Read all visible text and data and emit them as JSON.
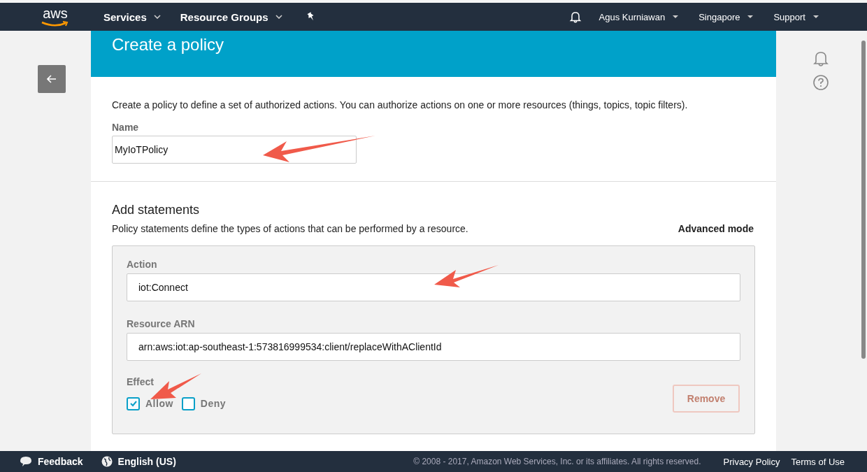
{
  "navbar": {
    "logo_text": "aws",
    "menus": [
      {
        "label": "Services"
      },
      {
        "label": "Resource Groups"
      }
    ],
    "user_menus": [
      {
        "label": "Agus Kurniawan"
      },
      {
        "label": "Singapore"
      },
      {
        "label": "Support"
      }
    ]
  },
  "page": {
    "title": "Create a policy",
    "description": "Create a policy to define a set of authorized actions. You can authorize actions on one or more resources (things, topics, topic filters).",
    "name_label": "Name",
    "name_value": "MyIoTPolicy"
  },
  "statements": {
    "title": "Add statements",
    "description": "Policy statements define the types of actions that can be performed by a resource.",
    "advanced_mode": "Advanced mode",
    "action_label": "Action",
    "action_value": "iot:Connect",
    "resource_label": "Resource ARN",
    "resource_value": "arn:aws:iot:ap-southeast-1:573816999534:client/replaceWithAClientId",
    "effect_label": "Effect",
    "effects": [
      {
        "label": "Allow",
        "checked": true
      },
      {
        "label": "Deny",
        "checked": false
      }
    ],
    "remove_button": {
      "label": "Remove",
      "disabled": true
    }
  },
  "footer": {
    "feedback": "Feedback",
    "language": "English (US)",
    "copyright": "© 2008 - 2017, Amazon Web Services, Inc. or its affiliates. All rights reserved.",
    "links": [
      "Privacy Policy",
      "Terms of Use"
    ]
  }
}
